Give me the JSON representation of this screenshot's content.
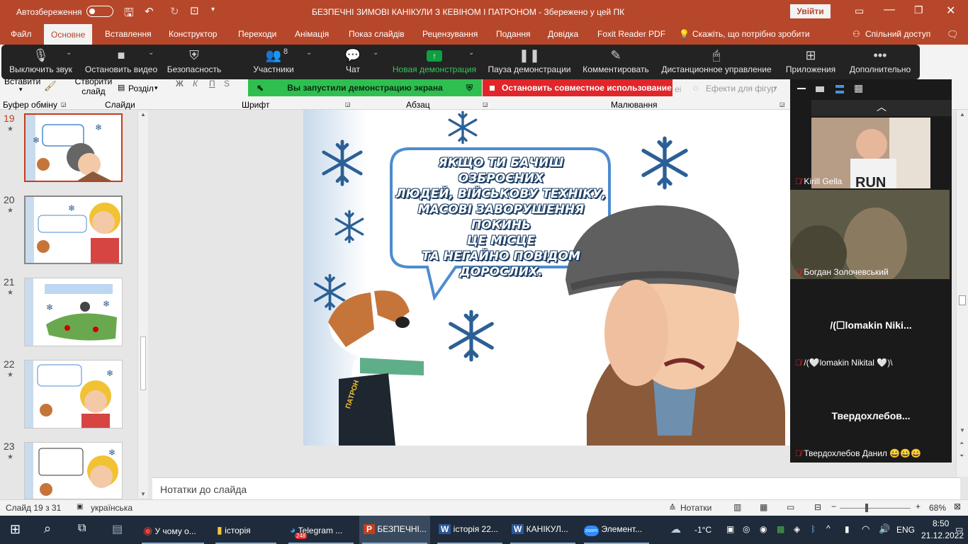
{
  "titlebar": {
    "autosave_label": "Автозбереження",
    "autosave_state": "Вимк",
    "title": "БЕЗПЕЧНІ ЗИМОВІ КАНІКУЛИ З КЕВІНОМ І ПАТРОНОМ  -  Збережено у цей ПК",
    "signin_label": "Увійти"
  },
  "ribbon_tabs": [
    "Файл",
    "Основне",
    "Вставлення",
    "Конструктор",
    "Переходи",
    "Анімація",
    "Показ слайдів",
    "Рецензування",
    "Подання",
    "Довідка",
    "Foxit Reader PDF"
  ],
  "ribbon_search": "Скажіть, що потрібно зробити",
  "ribbon_share": "Спільний доступ",
  "ribbon": {
    "paste": "Вставити",
    "new_slide": "Створити слайд",
    "section": "Розділ",
    "shape_effects": "Ефекти для фігур",
    "groups": [
      "Буфер обміну",
      "Слайди",
      "Шрифт",
      "Абзац",
      "Малювання"
    ]
  },
  "zoom_toolbar": {
    "mute": "Выключить звук",
    "video": "Остановить видео",
    "security": "Безопасность",
    "participants": "Участники",
    "participants_count": "8",
    "chat": "Чат",
    "new_share": "Новая демонстрация",
    "pause_share": "Пауза демонстрации",
    "annotate": "Комментировать",
    "remote_control": "Дистанционное управление",
    "apps": "Приложения",
    "more": "Дополнительно"
  },
  "share_banner": {
    "status": "Вы запустили демонстрацию экрана",
    "stop": "Остановить совместное использование"
  },
  "slides": [
    {
      "num": "19",
      "caption": "ЯКЩО ТИ БАЧИШ ОЗБРОЄНИХ ЛЮДЕЙ"
    },
    {
      "num": "20",
      "caption": ""
    },
    {
      "num": "21",
      "caption": ""
    },
    {
      "num": "22",
      "caption": ""
    },
    {
      "num": "23",
      "caption": ""
    }
  ],
  "slide_main": {
    "bubble_text": [
      "ЯКЩО ТИ БАЧИШ ОЗБРОЄНИХ",
      "ЛЮДЕЙ, ВІЙСЬКОВУ ТЕХНІКУ,",
      "МАСОВІ ЗАВОРУШЕННЯ ПОКИНЬ",
      "ЦЕ МІСЦЕ",
      "ТА НЕГАЙНО ПОВІДОМ ДОРОСЛИХ."
    ],
    "dog_vest_label": "ПАТРОН"
  },
  "notes_placeholder": "Нотатки до слайда",
  "statusbar": {
    "slide_info": "Слайд 19 з 31",
    "language": "українська",
    "notes_btn": "Нотатки",
    "zoom": "68%"
  },
  "zoom_participants": [
    {
      "name": "Kirill Gella"
    },
    {
      "name": "Богдан Золочевський"
    },
    {
      "name": "/(🤍lomakin Nikital 🤍)\\",
      "tile": "/(☐lomakin  Niki..."
    },
    {
      "name": "Твердохлебов Данил 😀😀😀",
      "tile": "Твердохлебов..."
    }
  ],
  "taskbar": {
    "items": [
      "У чому о...",
      "історія",
      "Telegram ...",
      "БЕЗПЕЧНІ...",
      "історія 22...",
      "КАНІКУЛ...",
      "Элемент..."
    ],
    "telegram_badge": "248",
    "weather": "-1°C",
    "lang": "ENG",
    "time": "8:50",
    "date": "21.12.2022"
  },
  "colors": {
    "accent": "#b7472a",
    "zoom_green": "#0e9f3e",
    "zoom_red": "#e0262a",
    "zoom_bg": "#232323"
  }
}
